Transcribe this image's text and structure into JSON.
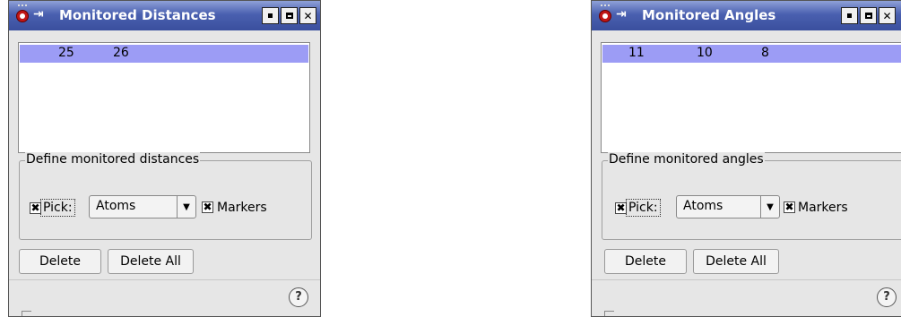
{
  "distances_window": {
    "title": "Monitored Distances",
    "list_row": [
      "25",
      "26"
    ],
    "group_label": "Define monitored distances",
    "pick_checked": "✖",
    "pick_label": "Pick:",
    "combo_value": "Atoms",
    "markers_checked": "✖",
    "markers_label": "Markers",
    "delete_label": "Delete",
    "delete_all_label": "Delete All",
    "help_label": "?"
  },
  "angles_window": {
    "title": "Monitored Angles",
    "list_row": [
      "11",
      "10",
      "8"
    ],
    "group_label": "Define monitored angles",
    "pick_checked": "✖",
    "pick_label": "Pick:",
    "combo_value": "Atoms",
    "markers_checked": "✖",
    "markers_label": "Markers",
    "delete_label": "Delete",
    "delete_all_label": "Delete All",
    "help_label": "?"
  },
  "icons": {
    "app": "app-icon",
    "pin": "pin-icon",
    "minimize": "minimize-icon",
    "maximize": "maximize-icon",
    "close": "close-icon",
    "dropdown": "chevron-down-icon",
    "help": "help-icon"
  }
}
